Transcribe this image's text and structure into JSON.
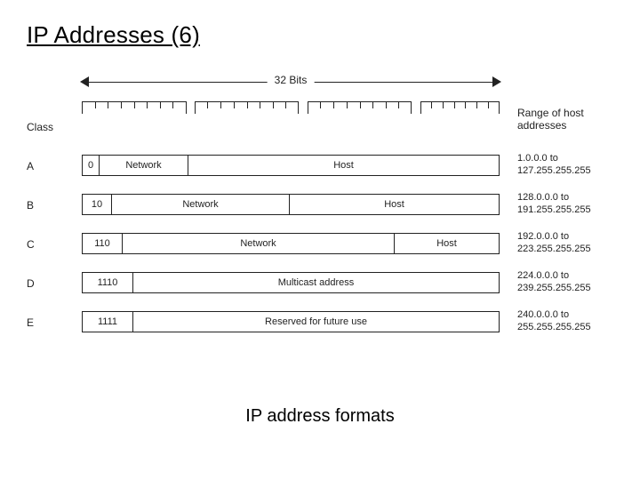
{
  "title": "IP Addresses (6)",
  "bits_label": "32 Bits",
  "class_header": "Class",
  "range_header_line1": "Range of host",
  "range_header_line2": "addresses",
  "caption": "IP address formats",
  "rows": {
    "A": {
      "label": "A",
      "prefix": "0",
      "seg2": "Network",
      "seg3": "Host",
      "range_from": "1.0.0.0 to",
      "range_to": "127.255.255.255"
    },
    "B": {
      "label": "B",
      "prefix": "10",
      "seg2": "Network",
      "seg3": "Host",
      "range_from": "128.0.0.0 to",
      "range_to": "191.255.255.255"
    },
    "C": {
      "label": "C",
      "prefix": "110",
      "seg2": "Network",
      "seg3": "Host",
      "range_from": "192.0.0.0 to",
      "range_to": "223.255.255.255"
    },
    "D": {
      "label": "D",
      "prefix": "1110",
      "seg2": "Multicast address",
      "range_from": "224.0.0.0 to",
      "range_to": "239.255.255.255"
    },
    "E": {
      "label": "E",
      "prefix": "1111",
      "seg2": "Reserved for future use",
      "range_from": "240.0.0.0 to",
      "range_to": "255.255.255.255"
    }
  },
  "chart_data": {
    "type": "table",
    "title": "IP address formats",
    "total_bits": 32,
    "classes": [
      {
        "class": "A",
        "prefix_bits": "0",
        "network_bits": 7,
        "host_bits": 24,
        "range": [
          "1.0.0.0",
          "127.255.255.255"
        ]
      },
      {
        "class": "B",
        "prefix_bits": "10",
        "network_bits": 14,
        "host_bits": 16,
        "range": [
          "128.0.0.0",
          "191.255.255.255"
        ]
      },
      {
        "class": "C",
        "prefix_bits": "110",
        "network_bits": 21,
        "host_bits": 8,
        "range": [
          "192.0.0.0",
          "223.255.255.255"
        ]
      },
      {
        "class": "D",
        "prefix_bits": "1110",
        "payload": "Multicast address",
        "range": [
          "224.0.0.0",
          "239.255.255.255"
        ]
      },
      {
        "class": "E",
        "prefix_bits": "1111",
        "payload": "Reserved for future use",
        "range": [
          "240.0.0.0",
          "255.255.255.255"
        ]
      }
    ]
  }
}
